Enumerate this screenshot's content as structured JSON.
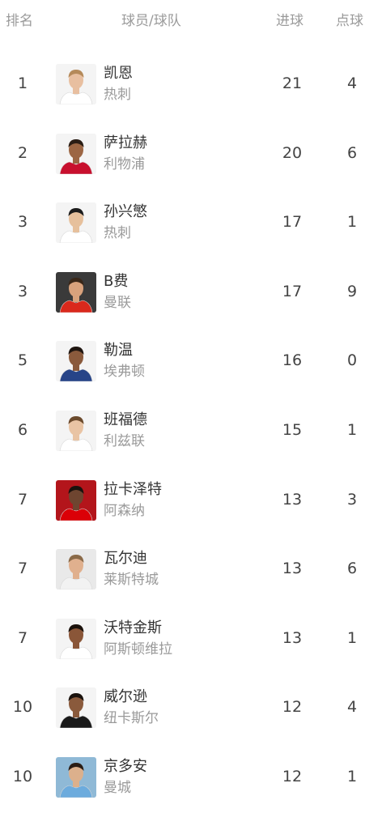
{
  "header": {
    "rank": "排名",
    "player_team": "球员/球队",
    "goals": "进球",
    "penalties": "点球"
  },
  "players": [
    {
      "rank": "1",
      "name": "凯恩",
      "team": "热刺",
      "goals": "21",
      "penalties": "4",
      "shirt": "#ffffff",
      "skin": "#e8bfa0",
      "hair": "#b58a5a",
      "bg": "#f4f4f4"
    },
    {
      "rank": "2",
      "name": "萨拉赫",
      "team": "利物浦",
      "goals": "20",
      "penalties": "6",
      "shirt": "#c8102e",
      "skin": "#9c6644",
      "hair": "#2a1d15",
      "bg": "#f4f4f4"
    },
    {
      "rank": "3",
      "name": "孙兴慜",
      "team": "热刺",
      "goals": "17",
      "penalties": "1",
      "shirt": "#ffffff",
      "skin": "#e6c09c",
      "hair": "#1c1c1c",
      "bg": "#f4f4f4"
    },
    {
      "rank": "3",
      "name": "B费",
      "team": "曼联",
      "goals": "17",
      "penalties": "9",
      "shirt": "#da291c",
      "skin": "#d9a27c",
      "hair": "#3a2718",
      "bg": "#3a3a3a"
    },
    {
      "rank": "5",
      "name": "勒温",
      "team": "埃弗顿",
      "goals": "16",
      "penalties": "0",
      "shirt": "#274488",
      "skin": "#8a5a3c",
      "hair": "#1f1611",
      "bg": "#f4f4f4"
    },
    {
      "rank": "6",
      "name": "班福德",
      "team": "利兹联",
      "goals": "15",
      "penalties": "1",
      "shirt": "#ffffff",
      "skin": "#e9c4a4",
      "hair": "#6b4a2c",
      "bg": "#f4f4f4"
    },
    {
      "rank": "7",
      "name": "拉卡泽特",
      "team": "阿森纳",
      "goals": "13",
      "penalties": "3",
      "shirt": "#db0007",
      "skin": "#6e4530",
      "hair": "#1a120d",
      "bg": "#b3151b"
    },
    {
      "rank": "7",
      "name": "瓦尔迪",
      "team": "莱斯特城",
      "goals": "13",
      "penalties": "6",
      "shirt": "#f2f2f2",
      "skin": "#e0b08e",
      "hair": "#8a6a48",
      "bg": "#e9e9e9"
    },
    {
      "rank": "7",
      "name": "沃特金斯",
      "team": "阿斯顿维拉",
      "goals": "13",
      "penalties": "1",
      "shirt": "#ffffff",
      "skin": "#8a5638",
      "hair": "#1b120c",
      "bg": "#f4f4f4"
    },
    {
      "rank": "10",
      "name": "威尔逊",
      "team": "纽卡斯尔",
      "goals": "12",
      "penalties": "4",
      "shirt": "#1a1a1a",
      "skin": "#8a5a3c",
      "hair": "#1a120d",
      "bg": "#f4f4f4"
    },
    {
      "rank": "10",
      "name": "京多安",
      "team": "曼城",
      "goals": "12",
      "penalties": "1",
      "shirt": "#6cabdd",
      "skin": "#dcb08c",
      "hair": "#2a1d15",
      "bg": "#8fb9d6"
    }
  ]
}
